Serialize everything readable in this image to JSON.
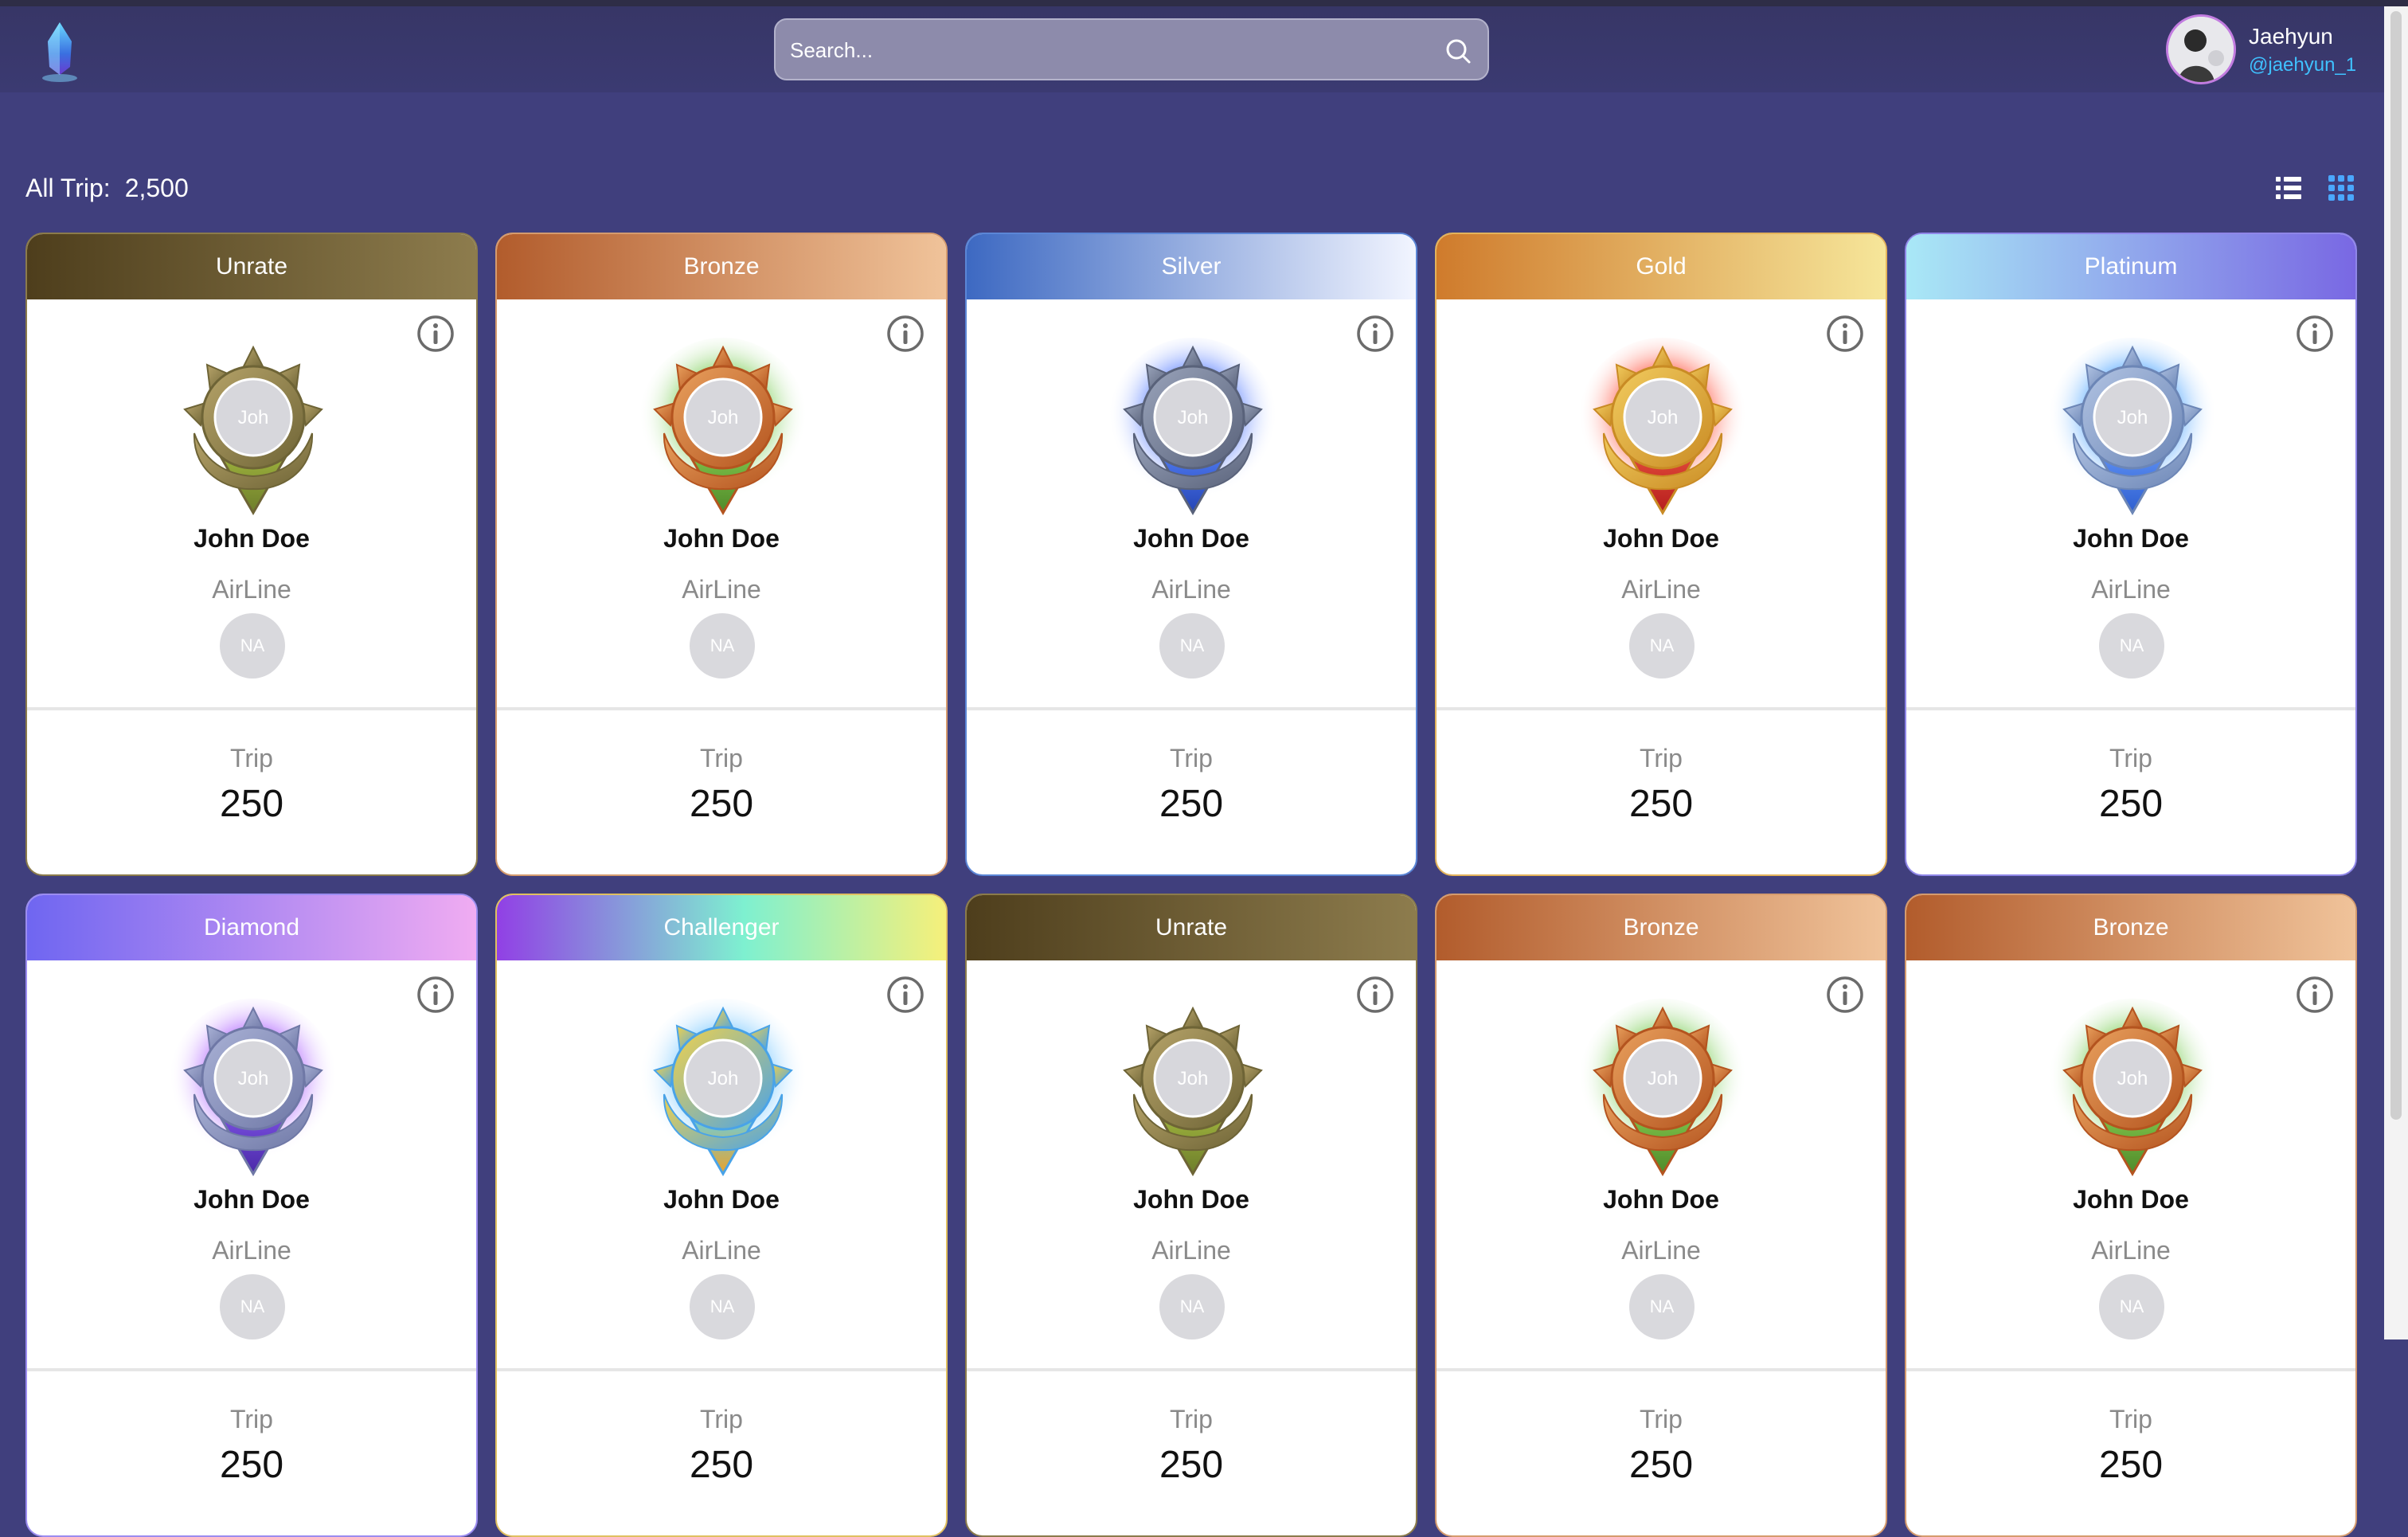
{
  "header": {
    "search_placeholder": "Search...",
    "user": {
      "name": "Jaehyun",
      "handle": "@jaehyun_1"
    }
  },
  "summary": {
    "label": "All Trip:",
    "value": "2,500"
  },
  "cards": [
    {
      "tier": "Unrate",
      "badge_text": "Joh",
      "name": "John Doe",
      "airline": "AirLine",
      "avatar_text": "NA",
      "trip_label": "Trip",
      "trip_value": "250"
    },
    {
      "tier": "Bronze",
      "badge_text": "Joh",
      "name": "John Doe",
      "airline": "AirLine",
      "avatar_text": "NA",
      "trip_label": "Trip",
      "trip_value": "250"
    },
    {
      "tier": "Silver",
      "badge_text": "Joh",
      "name": "John Doe",
      "airline": "AirLine",
      "avatar_text": "NA",
      "trip_label": "Trip",
      "trip_value": "250"
    },
    {
      "tier": "Gold",
      "badge_text": "Joh",
      "name": "John Doe",
      "airline": "AirLine",
      "avatar_text": "NA",
      "trip_label": "Trip",
      "trip_value": "250"
    },
    {
      "tier": "Platinum",
      "badge_text": "Joh",
      "name": "John Doe",
      "airline": "AirLine",
      "avatar_text": "NA",
      "trip_label": "Trip",
      "trip_value": "250"
    },
    {
      "tier": "Diamond",
      "badge_text": "Joh",
      "name": "John Doe",
      "airline": "AirLine",
      "avatar_text": "NA",
      "trip_label": "Trip",
      "trip_value": "250"
    },
    {
      "tier": "Challenger",
      "badge_text": "Joh",
      "name": "John Doe",
      "airline": "AirLine",
      "avatar_text": "NA",
      "trip_label": "Trip",
      "trip_value": "250"
    },
    {
      "tier": "Unrate",
      "badge_text": "Joh",
      "name": "John Doe",
      "airline": "AirLine",
      "avatar_text": "NA",
      "trip_label": "Trip",
      "trip_value": "250"
    },
    {
      "tier": "Bronze",
      "badge_text": "Joh",
      "name": "John Doe",
      "airline": "AirLine",
      "avatar_text": "NA",
      "trip_label": "Trip",
      "trip_value": "250"
    },
    {
      "tier": "Bronze",
      "badge_text": "Joh",
      "name": "John Doe",
      "airline": "AirLine",
      "avatar_text": "NA",
      "trip_label": "Trip",
      "trip_value": "250"
    }
  ],
  "colors": {
    "background": "#403f7d",
    "accent_handle": "#3fc1ff",
    "grid_icon_active": "#4aa8ff"
  },
  "icons": {
    "logo": "crystal-logo-icon",
    "search": "search-icon",
    "list_view": "list-view-icon",
    "grid_view": "grid-view-icon",
    "info": "info-icon",
    "badge": "rank-badge-icon"
  }
}
